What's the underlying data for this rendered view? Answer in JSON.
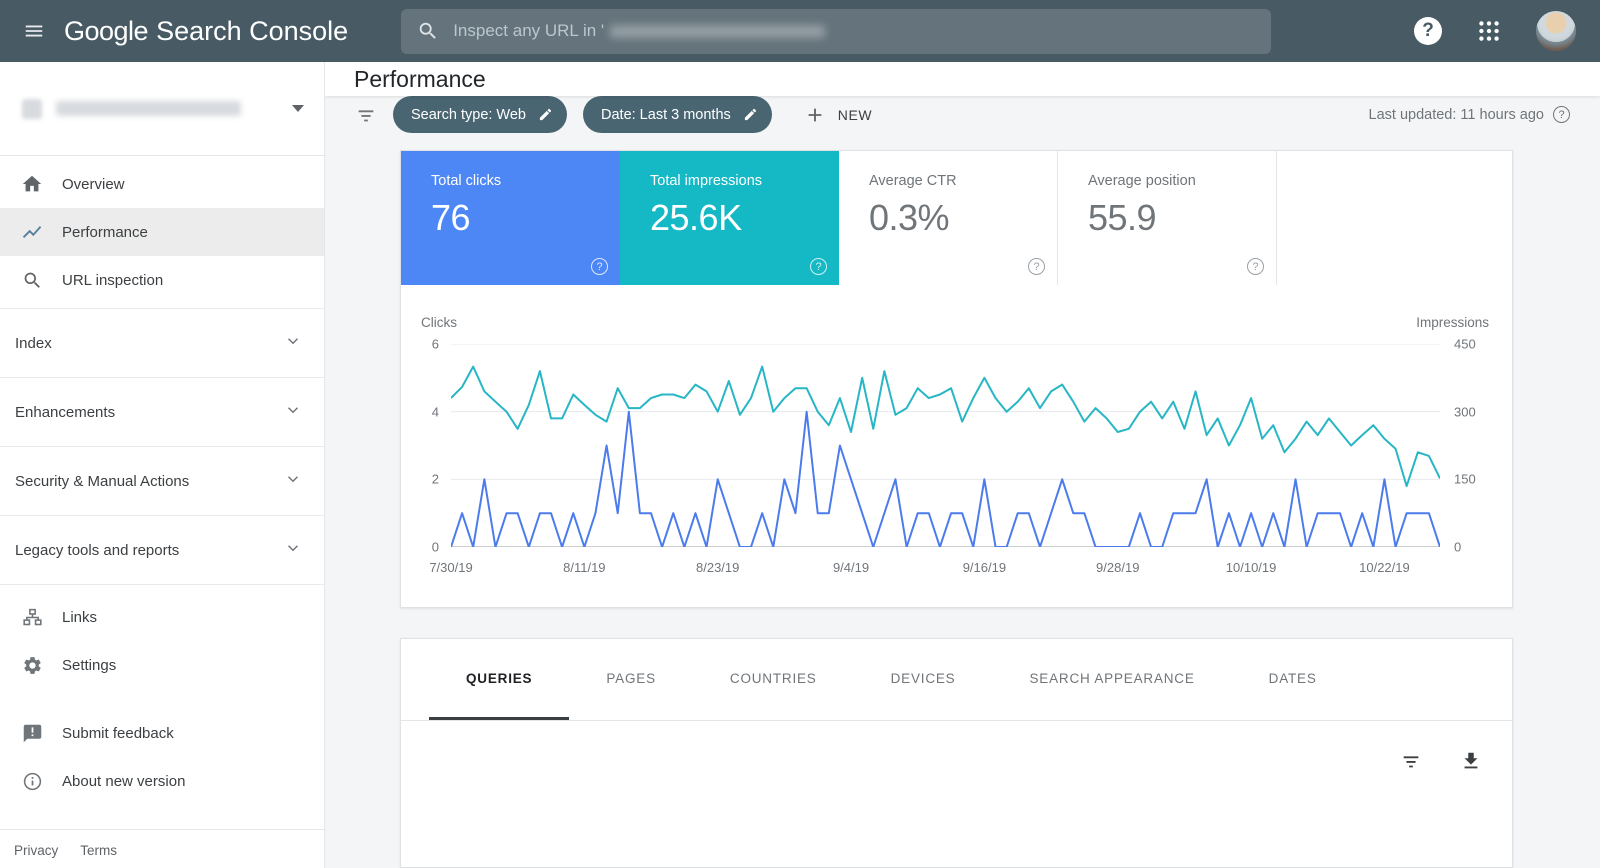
{
  "topbar": {
    "logo": {
      "google": "Google",
      "product": "Search Console"
    },
    "search": {
      "placeholder_prefix": "Inspect any URL in '"
    }
  },
  "sidebar": {
    "nav": [
      {
        "label": "Overview"
      },
      {
        "label": "Performance"
      },
      {
        "label": "URL inspection"
      }
    ],
    "sections": [
      {
        "label": "Index"
      },
      {
        "label": "Enhancements"
      },
      {
        "label": "Security & Manual Actions"
      },
      {
        "label": "Legacy tools and reports"
      }
    ],
    "tools": [
      {
        "label": "Links"
      },
      {
        "label": "Settings"
      }
    ],
    "meta": [
      {
        "label": "Submit feedback"
      },
      {
        "label": "About new version"
      }
    ],
    "footer": {
      "privacy": "Privacy",
      "terms": "Terms"
    }
  },
  "page": {
    "title": "Performance"
  },
  "filterbar": {
    "chips": [
      {
        "label": "Search type: Web"
      },
      {
        "label": "Date: Last 3 months"
      }
    ],
    "new_button": "NEW",
    "last_updated": "Last updated: 11 hours ago"
  },
  "metrics": [
    {
      "label": "Total clicks",
      "value": "76",
      "selected": true,
      "color": "#4d87f5"
    },
    {
      "label": "Total impressions",
      "value": "25.6K",
      "selected": true,
      "color": "#15b9c5"
    },
    {
      "label": "Average CTR",
      "value": "0.3%",
      "selected": false
    },
    {
      "label": "Average position",
      "value": "55.9",
      "selected": false
    }
  ],
  "chart_data": {
    "type": "line",
    "title": "Clicks and Impressions over time",
    "x_tick_labels": [
      "7/30/19",
      "8/11/19",
      "8/23/19",
      "9/4/19",
      "9/16/19",
      "9/28/19",
      "10/10/19",
      "10/22/19"
    ],
    "x_tick_day_indices": [
      0,
      12,
      24,
      36,
      48,
      60,
      72,
      84
    ],
    "n_points": 90,
    "grid": true,
    "left_axis": {
      "label": "Clicks",
      "ticks": [
        0,
        2,
        4,
        6
      ],
      "ylim": [
        0,
        6
      ]
    },
    "right_axis": {
      "label": "Impressions",
      "ticks": [
        0,
        150,
        300,
        450
      ],
      "ylim": [
        0,
        450
      ]
    },
    "series": [
      {
        "name": "Clicks",
        "axis": "left",
        "color": "#4b7bec",
        "values": [
          0,
          1,
          0,
          2,
          0,
          1,
          1,
          0,
          1,
          1,
          0,
          1,
          0,
          1,
          3,
          1,
          4,
          1,
          1,
          0,
          1,
          0,
          1,
          0,
          2,
          1,
          0,
          0,
          1,
          0,
          2,
          1,
          4,
          1,
          1,
          3,
          2,
          1,
          0,
          1,
          2,
          0,
          1,
          1,
          0,
          1,
          1,
          0,
          2,
          0,
          0,
          1,
          1,
          0,
          1,
          2,
          1,
          1,
          0,
          0,
          0,
          0,
          1,
          0,
          0,
          1,
          1,
          1,
          2,
          0,
          1,
          0,
          1,
          0,
          1,
          0,
          2,
          0,
          1,
          1,
          1,
          0,
          1,
          0,
          2,
          0,
          1,
          1,
          1,
          0
        ]
      },
      {
        "name": "Impressions",
        "axis": "right",
        "color": "#27b6c5",
        "values": [
          330,
          355,
          400,
          345,
          322,
          300,
          262,
          315,
          390,
          285,
          285,
          338,
          315,
          293,
          278,
          352,
          308,
          308,
          330,
          338,
          338,
          330,
          360,
          345,
          300,
          368,
          293,
          330,
          400,
          300,
          330,
          352,
          352,
          300,
          270,
          330,
          255,
          375,
          262,
          390,
          293,
          308,
          352,
          330,
          338,
          352,
          278,
          330,
          375,
          330,
          300,
          322,
          352,
          308,
          345,
          360,
          322,
          278,
          308,
          285,
          255,
          262,
          300,
          322,
          285,
          322,
          262,
          345,
          248,
          285,
          225,
          270,
          330,
          240,
          270,
          210,
          240,
          278,
          248,
          285,
          255,
          225,
          248,
          270,
          240,
          218,
          135,
          210,
          202,
          152
        ]
      }
    ]
  },
  "tabs": [
    {
      "label": "QUERIES",
      "active": true
    },
    {
      "label": "PAGES",
      "active": false
    },
    {
      "label": "COUNTRIES",
      "active": false
    },
    {
      "label": "DEVICES",
      "active": false
    },
    {
      "label": "SEARCH APPEARANCE",
      "active": false
    },
    {
      "label": "DATES",
      "active": false
    }
  ]
}
